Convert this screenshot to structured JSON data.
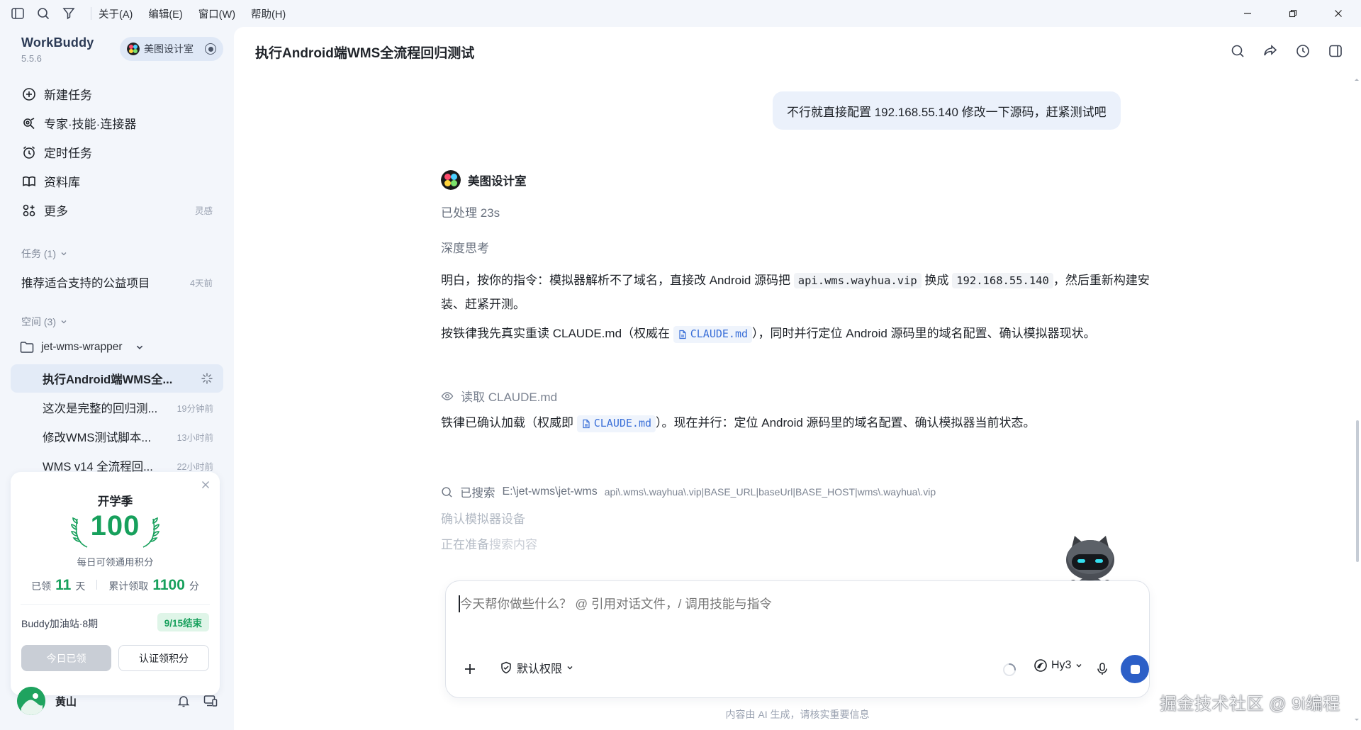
{
  "menu": [
    "关于(A)",
    "编辑(E)",
    "窗口(W)",
    "帮助(H)"
  ],
  "brand": {
    "name": "WorkBuddy",
    "version": "5.5.6"
  },
  "workspace": {
    "name": "美图设计室"
  },
  "nav": [
    {
      "label": "新建任务",
      "icon": "new-task-icon"
    },
    {
      "label": "专家·技能·连接器",
      "icon": "expert-icon"
    },
    {
      "label": "定时任务",
      "icon": "alarm-clock-icon"
    },
    {
      "label": "资料库",
      "icon": "book-icon"
    },
    {
      "label": "更多",
      "icon": "apps-icon",
      "aside": "灵感"
    }
  ],
  "tasks": {
    "label": "任务 (1)",
    "items": [
      {
        "label": "推荐适合支持的公益项目",
        "time": "4天前"
      }
    ]
  },
  "spaces": {
    "label": "空间 (3)",
    "folder": "jet-wms-wrapper",
    "items": [
      {
        "label": "执行Android端WMS全...",
        "time": ""
      },
      {
        "label": "这次是完整的回归测...",
        "time": "19分钟前"
      },
      {
        "label": "修改WMS测试脚本...",
        "time": "13小时前"
      },
      {
        "label": "WMS v14 全流程回...",
        "time": "22小时前"
      }
    ]
  },
  "promo": {
    "title": "开学季",
    "number": "100",
    "subtitle": "每日可领通用积分",
    "stat1_prefix": "已领",
    "stat1_value": "11",
    "stat1_unit": "天",
    "stat2_prefix": "累计领取",
    "stat2_value": "1100",
    "stat2_unit": "分",
    "station": "Buddy加油站·8期",
    "tag": "9/15结束",
    "btn_claimed": "今日已领",
    "btn_verify": "认证领积分"
  },
  "user": {
    "name": "黄山"
  },
  "main": {
    "title": "执行Android端WMS全流程回归测试",
    "user_message": "不行就直接配置 192.168.55.140 修改一下源码，赶紧测试吧",
    "bot_name": "美图设计室",
    "processed": "已处理 23s",
    "deep_think": "深度思考",
    "para1_a": "明白，按你的指令：模拟器解析不了域名，直接改 Android 源码把 ",
    "para1_code1": "api.wms.wayhua.vip",
    "para1_b": " 换成 ",
    "para1_code2": "192.168.55.140",
    "para1_c": "，然后重新构建安装、赶紧开测。",
    "para2_a": "按铁律我先真实重读 CLAUDE.md（权威在 ",
    "para2_link": "CLAUDE.md",
    "para2_b": "），同时并行定位 Android 源码里的域名配置、确认模拟器现状。",
    "step_read": "读取 CLAUDE.md",
    "para3_a": "铁律已确认加载（权威即 ",
    "para3_link": "CLAUDE.md",
    "para3_b": "）。现在并行：定位 Android 源码里的域名配置、确认模拟器当前状态。",
    "search_label": "已搜索",
    "search_path": "E:\\jet-wms\\jet-wms",
    "search_query": "api\\.wms\\.wayhua\\.vip|BASE_URL|baseUrl|BASE_HOST|wms\\.wayhua\\.vip",
    "faded1": "确认模拟器设备",
    "faded2_a": "正在准备",
    "faded2_b": "搜索内容"
  },
  "composer": {
    "placeholder": "今天帮你做些什么？ @ 引用对话文件，/ 调用技能与指令",
    "permission": "默认权限",
    "model": "Hy3"
  },
  "disclaimer": "内容由 AI 生成，请核实重要信息",
  "watermark": "掘金技术社区 @ 9i编程",
  "colors": {
    "accent": "#2c5fc7",
    "green": "#17a05c",
    "sidebar_bg": "#f3f6fb"
  }
}
